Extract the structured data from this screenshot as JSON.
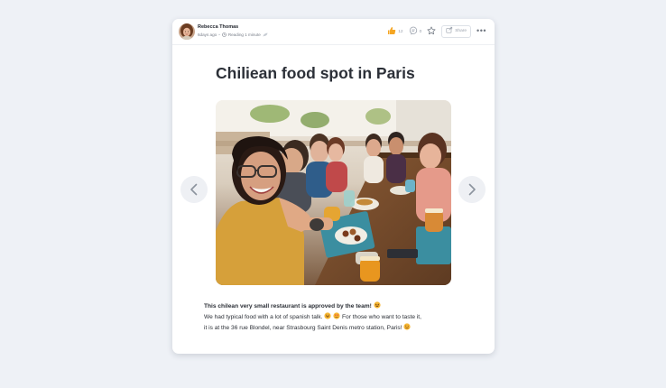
{
  "post": {
    "author": {
      "name": "Rebecca Thomas",
      "time_ago": "6days ago",
      "separator": "•",
      "reading": "Reading 1 minute"
    },
    "actions": {
      "likes_count": "12",
      "comments_count": "0",
      "share_label": "Share",
      "more_label": "•••"
    },
    "title": "Chiliean food spot in Paris",
    "body": {
      "line1": "This chilean very small restaurant is approved by the team!",
      "line2": "We had typical food with a lot of spanish talk.",
      "line2b": "For those who want to taste it,",
      "line3": "it is at the 36 rue Blondel, near Strasbourg Saint Denis metro station, Paris!"
    }
  },
  "colors": {
    "background": "#eef1f6",
    "card": "#ffffff",
    "like_accent": "#f5a623",
    "emoji": "#f7b733"
  },
  "icons": {
    "like": "thumbs-up-icon",
    "comment": "comment-icon",
    "bookmark": "star-icon",
    "share": "share-icon",
    "more": "more-dots-icon",
    "prev": "chevron-left-icon",
    "next": "chevron-right-icon",
    "clock": "clock-icon",
    "reading": "leaf-icon"
  }
}
